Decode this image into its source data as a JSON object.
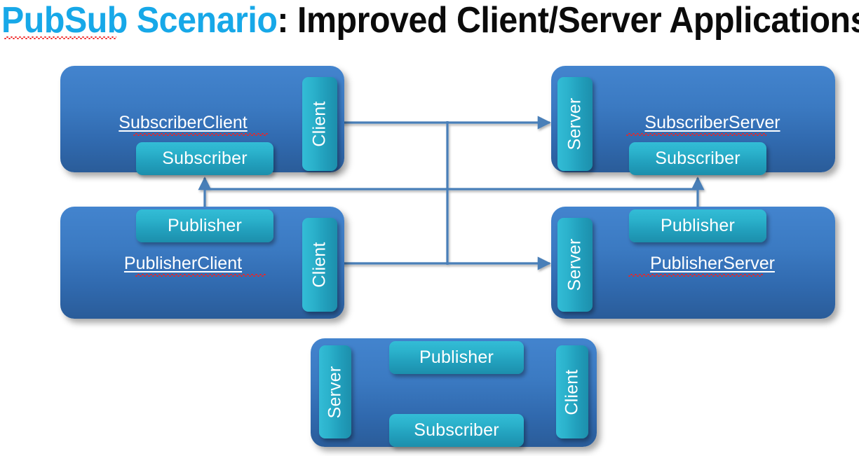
{
  "title": {
    "accent_text": "PubSub Scenario",
    "rest_text": ": Improved Client/Server Applications",
    "accent_color": "#17A8E8",
    "rest_color": "#0b0b0b",
    "spellcheck_underline_color": "#ef2424"
  },
  "theme": {
    "node_box_top": "#4384CE",
    "node_box_bottom": "#2A5C99",
    "component_box_top": "#33BCD6",
    "component_box_bottom": "#1C8FAC",
    "connector_color": "#4A7FB8",
    "label_color": "#ffffff",
    "page_background": "#ffffff"
  },
  "nodes": [
    {
      "id": "subscriber-client",
      "title": "SubscriberClient",
      "tab": {
        "label": "Client",
        "side": "right"
      },
      "components": [
        {
          "label": "Subscriber"
        }
      ]
    },
    {
      "id": "subscriber-server",
      "title": "SubscriberServer",
      "tab": {
        "label": "Server",
        "side": "left"
      },
      "components": [
        {
          "label": "Subscriber"
        }
      ]
    },
    {
      "id": "publisher-client",
      "title": "PublisherClient",
      "tab": {
        "label": "Client",
        "side": "right"
      },
      "components": [
        {
          "label": "Publisher"
        }
      ]
    },
    {
      "id": "publisher-server",
      "title": "PublisherServer",
      "tab": {
        "label": "Server",
        "side": "left"
      },
      "components": [
        {
          "label": "Publisher"
        }
      ]
    },
    {
      "id": "combined-node",
      "title": "",
      "tabs": [
        {
          "label": "Server",
          "side": "left"
        },
        {
          "label": "Client",
          "side": "right"
        }
      ],
      "components": [
        {
          "label": "Publisher"
        },
        {
          "label": "Subscriber"
        }
      ]
    }
  ],
  "connections": [
    {
      "from": "subscriber-client-tab-client",
      "to": "subscriber-server-tab-server",
      "direction": "right"
    },
    {
      "from": "publisher-client-tab-client",
      "to": "publisher-server-tab-server",
      "direction": "right"
    },
    {
      "from": "publisher-client-publisher",
      "to": "subscriber-client-subscriber",
      "direction": "up"
    },
    {
      "from": "publisher-server-publisher",
      "to": "subscriber-server-subscriber",
      "direction": "up"
    }
  ]
}
